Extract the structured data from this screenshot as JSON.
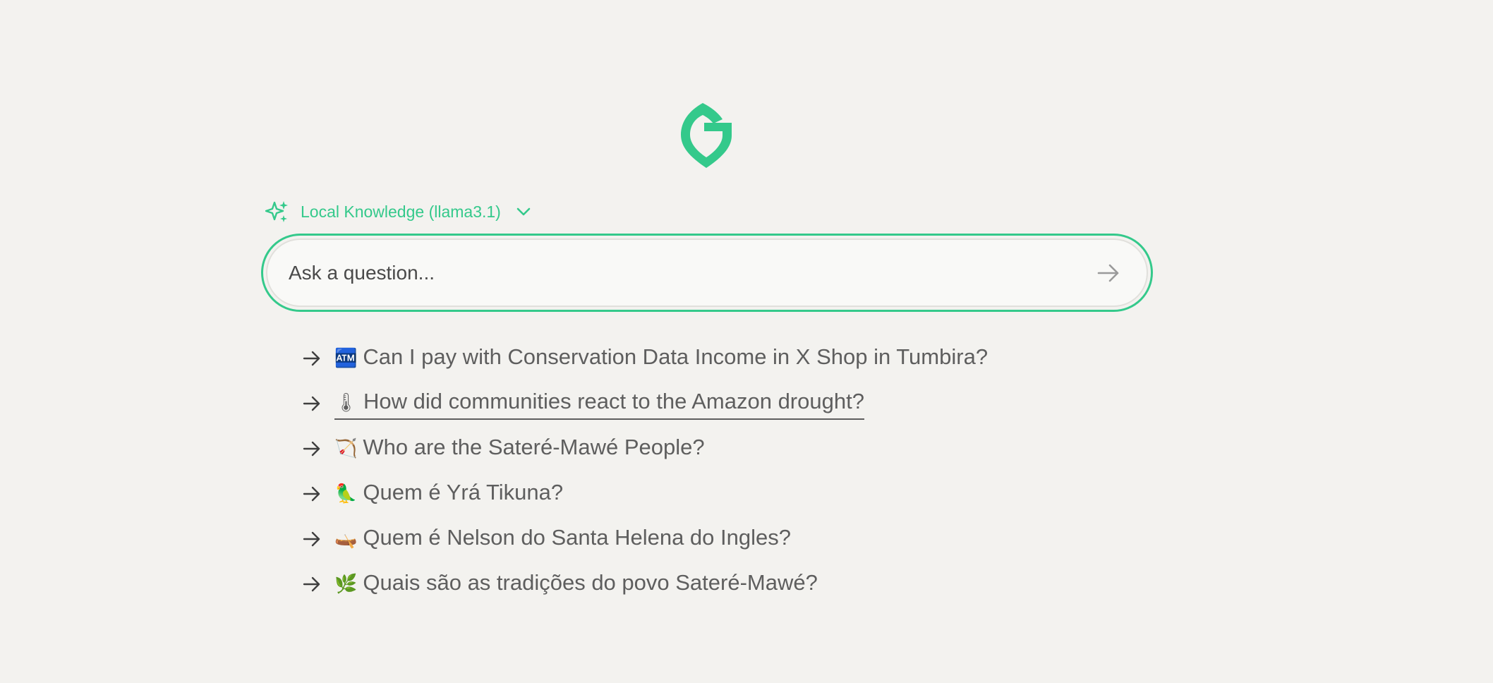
{
  "colors": {
    "accent": "#34c98b",
    "text": "#5e5e5e",
    "background": "#f3f2ef"
  },
  "logo": {
    "icon": "g-leaf-logo-icon"
  },
  "model_selector": {
    "icon": "sparkle-icon",
    "label": "Local Knowledge (llama3.1)",
    "dropdown_icon": "chevron-down-icon"
  },
  "search": {
    "placeholder": "Ask a question...",
    "value": "",
    "submit_icon": "arrow-right-icon"
  },
  "suggestions": [
    {
      "emoji": "🏧",
      "text": "Can I pay with Conservation Data Income in X Shop in Tumbira?",
      "hovered": false
    },
    {
      "emoji": "🌡",
      "text": "How did communities react to the Amazon drought?",
      "hovered": true
    },
    {
      "emoji": "🏹",
      "text": "Who are the Sateré-Mawé People?",
      "hovered": false
    },
    {
      "emoji": "🦜",
      "text": "Quem é Yrá Tikuna?",
      "hovered": false
    },
    {
      "emoji": "🛶",
      "text": "Quem é Nelson do Santa Helena do Ingles?",
      "hovered": false
    },
    {
      "emoji": "🌿",
      "text": "Quais são as tradições do povo Sateré-Mawé?",
      "hovered": false
    }
  ]
}
